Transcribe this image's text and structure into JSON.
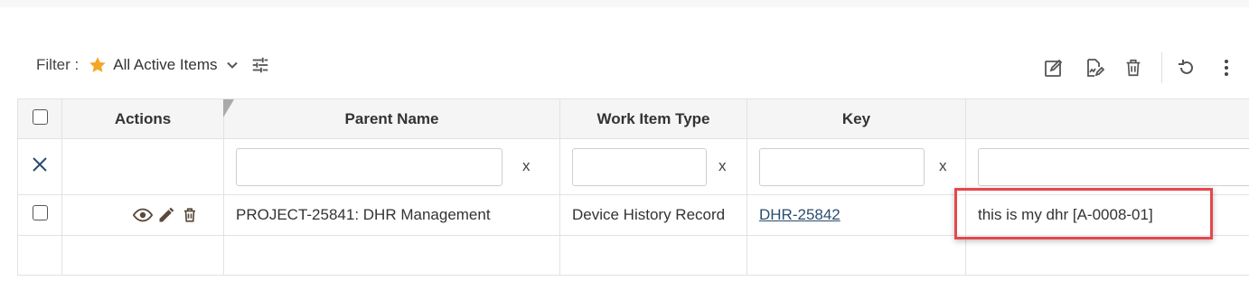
{
  "filter": {
    "label": "Filter :",
    "selected_view": "All Active Items",
    "star_color": "#f5a623"
  },
  "toolbar": {
    "icons": [
      "edit-square-icon",
      "edit-document-icon",
      "delete-icon",
      "refresh-icon",
      "more-vert-icon"
    ]
  },
  "table": {
    "columns": [
      "",
      "Actions",
      "Parent Name",
      "Work Item Type",
      "Key",
      ""
    ],
    "filter_clear_glyph": "x",
    "rows": [
      {
        "parent_name": "PROJECT-25841: DHR Management",
        "work_item_type": "Device History Record",
        "key": "DHR-25842",
        "description": "this is my dhr [A-0008-01]"
      }
    ]
  },
  "colors": {
    "highlight": "#e5484d",
    "link": "#2a4d6e",
    "header_bg": "#f5f5f5"
  }
}
